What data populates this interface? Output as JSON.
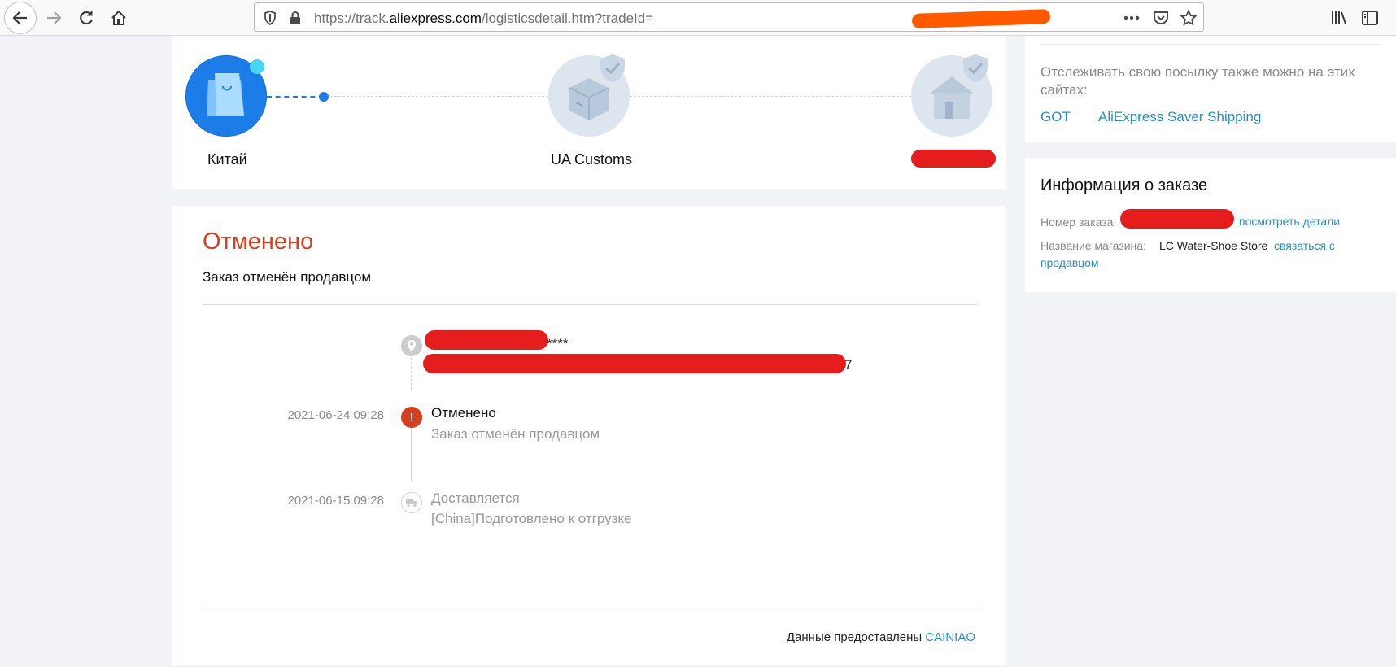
{
  "browser": {
    "url_prefix": "https://track.",
    "url_domain": "aliexpress.com",
    "url_path": "/logisticsdetail.htm?tradeId="
  },
  "progress": {
    "steps": [
      {
        "label": "Китай",
        "state": "active"
      },
      {
        "label": "UA Customs",
        "state": "pending"
      },
      {
        "label": "",
        "state": "pending"
      }
    ]
  },
  "status": {
    "title": "Отменено",
    "subtitle": "Заказ отменён продавцом",
    "address_suffix_1": "****",
    "address_suffix_2": "7",
    "events": [
      {
        "time": "2021-06-24 09:28",
        "title": "Отменено",
        "desc": "Заказ отменён продавцом"
      },
      {
        "time": "2021-06-15 09:28",
        "title": "Доставляется",
        "desc": "[China]Подготовлено к отгрузке"
      }
    ],
    "footer_text": "Данные предоставлены ",
    "footer_link": "CAINIAO"
  },
  "sidebar": {
    "tracking_text": "Отслеживать свою посылку также можно на этих сайтах:",
    "tracking_links": [
      "GOT",
      "AliExpress Saver Shipping"
    ],
    "order_title": "Информация о заказе",
    "order_number_label": "Номер заказа:",
    "order_details_link": "посмотреть детали",
    "store_label": "Название магазина:",
    "store_name": "LC Water-Shoe Store",
    "contact_link": "связаться с продавцом"
  },
  "colors": {
    "accent_blue": "#1c7de8",
    "status_red": "#d4401f",
    "link_blue": "#2a8fbd"
  }
}
